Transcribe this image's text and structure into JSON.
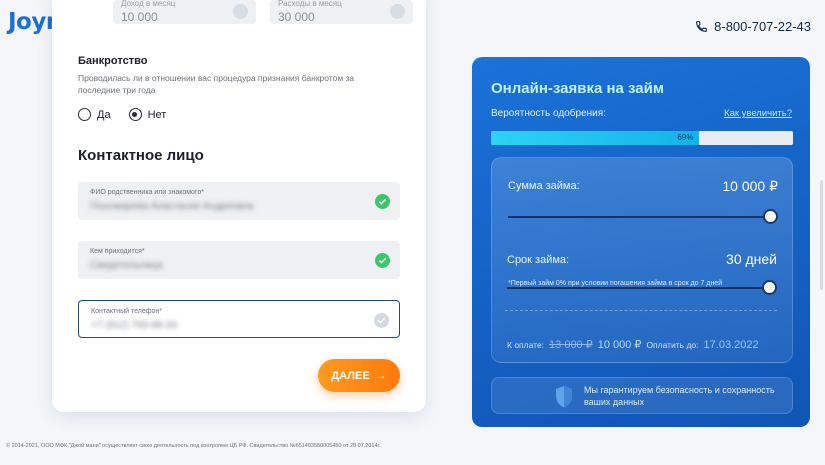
{
  "header": {
    "logo": "Joymoney",
    "phone": "8-800-707-22-43"
  },
  "top_fields": [
    {
      "label": "Доход в месяц",
      "value": "10 000"
    },
    {
      "label": "Расходы в месяц",
      "value": "30 000"
    }
  ],
  "bankruptcy": {
    "title": "Банкротство",
    "description": "Проводилась ли в отношении вас процедура признания банкротом за последние три года",
    "options": [
      {
        "label": "Да",
        "selected": false
      },
      {
        "label": "Нет",
        "selected": true
      }
    ]
  },
  "contact": {
    "title": "Контактное лицо",
    "fields": [
      {
        "label": "ФИО родственника или знакомого*",
        "value": "Пономарева Анастасия Андреевна",
        "valid": true
      },
      {
        "label": "Кем приходится*",
        "value": "Свидетельница",
        "valid": true
      },
      {
        "label": "Контактный телефон*",
        "value": "+7 (912) 765-88-33",
        "valid": false
      }
    ]
  },
  "next_button": "ДАЛЕЕ",
  "panel": {
    "title": "Онлайн-заявка на займ",
    "probability_label": "Вероятность одобрения:",
    "how_to_increase": "Как увеличить?",
    "probability_value": 0.69,
    "probability_text": "69%",
    "amount_label": "Сумма займа:",
    "amount_value": "10 000 ₽",
    "amount_slider": 1.0,
    "note": "*Первый займ 0% при условии погашения займа в срок до 7 дней",
    "term_label": "Срок займа:",
    "term_value": "30 дней",
    "term_slider": 1.0,
    "pay_label": "К оплате:",
    "pay_old": "13 000 ₽",
    "pay_new": "10 000 ₽",
    "pay_until_label": "Оплатить до:",
    "pay_until": "17.03.2022",
    "guarantee": "Мы гарантируем безопасность и сохранность ваших данных"
  },
  "footer": "© 2014-2021, ООО МФК \"Джой мани\" осуществляет свою деятельность под контролем ЦБ РФ. Свидетельство №651403550005450 от 28.07.2014г.",
  "colors": {
    "brand": "#1b6fd6",
    "accent_orange": "#ff8a14",
    "panel_blue": "#1665c9",
    "valid_green": "#3bc66a"
  }
}
